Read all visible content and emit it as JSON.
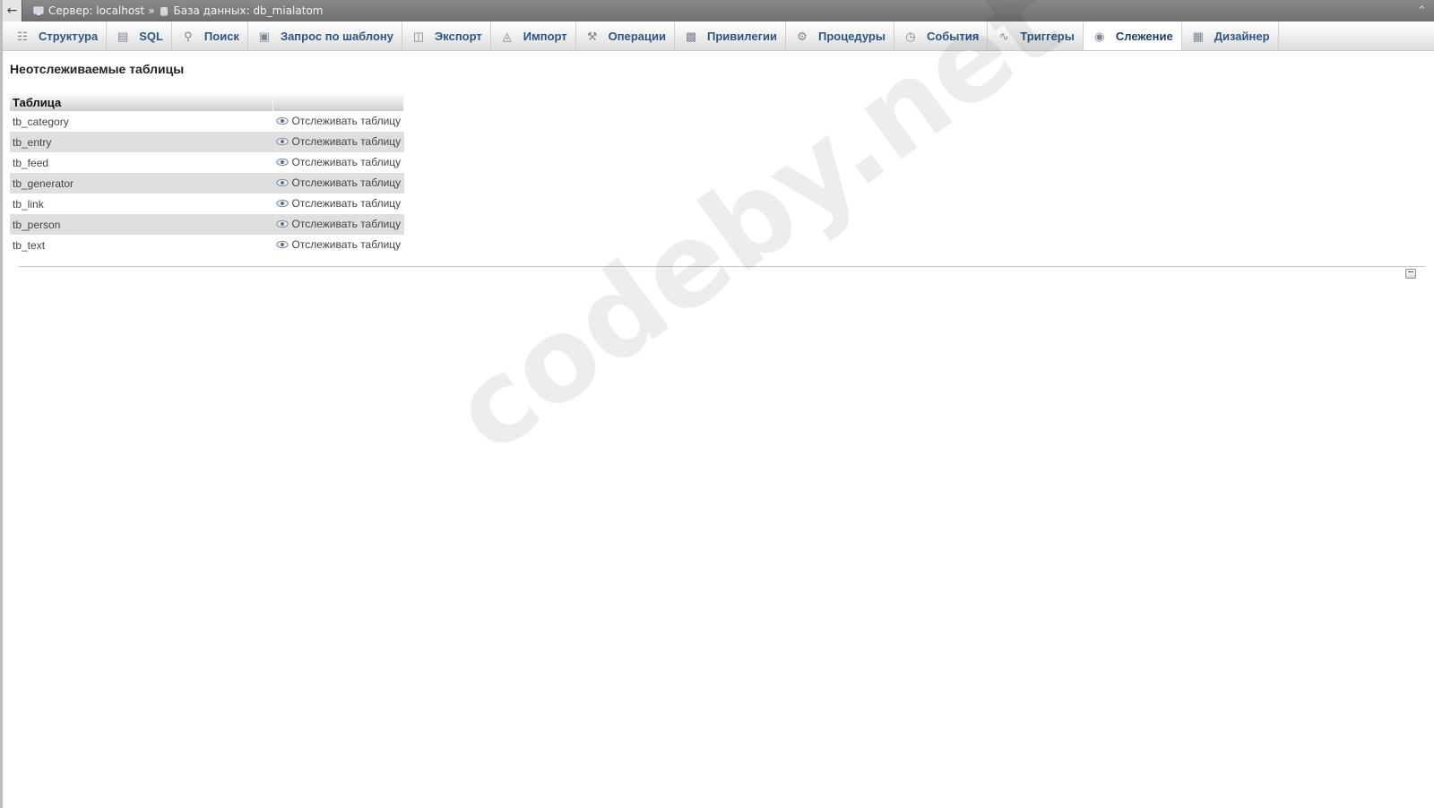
{
  "topbar": {
    "back_icon": "arrow-left-icon",
    "server_label": "Сервер: localhost",
    "separator": "»",
    "database_label": "База данных: db_mialatom",
    "collapse_icon": "chevron-up-icon"
  },
  "tabs": [
    {
      "label": "Структура",
      "icon": "structure-icon",
      "active": false
    },
    {
      "label": "SQL",
      "icon": "sql-icon",
      "active": false
    },
    {
      "label": "Поиск",
      "icon": "search-icon",
      "active": false
    },
    {
      "label": "Запрос по шаблону",
      "icon": "query-icon",
      "active": false
    },
    {
      "label": "Экспорт",
      "icon": "export-icon",
      "active": false
    },
    {
      "label": "Импорт",
      "icon": "import-icon",
      "active": false
    },
    {
      "label": "Операции",
      "icon": "wrench-icon",
      "active": false
    },
    {
      "label": "Привилегии",
      "icon": "privileges-icon",
      "active": false
    },
    {
      "label": "Процедуры",
      "icon": "routines-icon",
      "active": false
    },
    {
      "label": "События",
      "icon": "clock-icon",
      "active": false
    },
    {
      "label": "Триггеры",
      "icon": "triggers-icon",
      "active": false
    },
    {
      "label": "Слежение",
      "icon": "eye-icon",
      "active": true
    },
    {
      "label": "Дизайнер",
      "icon": "designer-icon",
      "active": false
    }
  ],
  "main": {
    "section_title": "Неотслеживаемые таблицы",
    "table": {
      "headers": [
        "Таблица",
        ""
      ],
      "action_label": "Отслеживать таблицу",
      "rows": [
        {
          "name": "tb_category"
        },
        {
          "name": "tb_entry"
        },
        {
          "name": "tb_feed"
        },
        {
          "name": "tb_generator"
        },
        {
          "name": "tb_link"
        },
        {
          "name": "tb_person"
        },
        {
          "name": "tb_text"
        }
      ]
    }
  },
  "watermark": "codeby.net",
  "colors": {
    "tab_text": "#2e5486",
    "topbar_bg": "#7c7c7c",
    "row_alt": "#dfdfdf"
  }
}
